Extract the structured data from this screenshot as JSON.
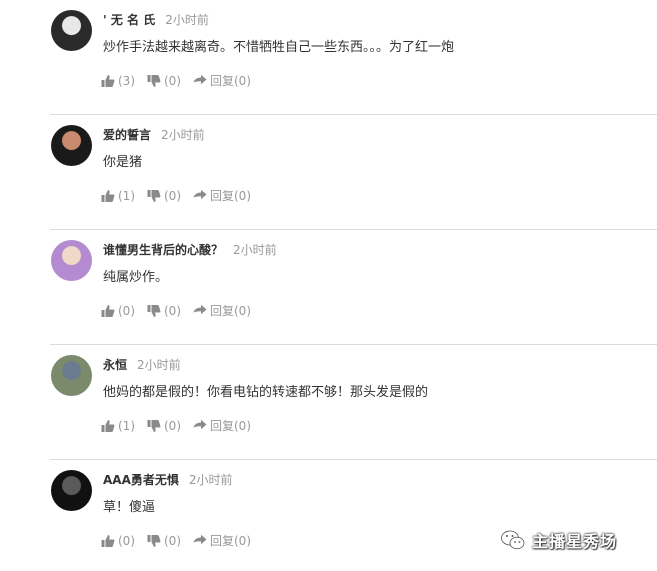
{
  "comments": [
    {
      "username": "' 无 名 氏",
      "time": "2小时前",
      "text": "炒作手法越来越离奇。不惜牺牲自己一些东西。。。为了红一炮",
      "likes": "(3)",
      "dislikes": "(0)",
      "reply": "回复(0)",
      "avatar_colors": [
        "#2a2a2a",
        "#e8e8e8"
      ]
    },
    {
      "username": "爱的誓言",
      "time": "2小时前",
      "text": "你是猪",
      "likes": "(1)",
      "dislikes": "(0)",
      "reply": "回复(0)",
      "avatar_colors": [
        "#1a1a1a",
        "#c98a70"
      ]
    },
    {
      "username": "谁懂男生背后的心酸？",
      "time": "2小时前",
      "text": "纯属炒作。",
      "likes": "(0)",
      "dislikes": "(0)",
      "reply": "回复(0)",
      "avatar_colors": [
        "#b48bd0",
        "#f0d9c8"
      ]
    },
    {
      "username": "永恒",
      "time": "2小时前",
      "text": "他妈的都是假的！你看电钻的转速都不够！那头发是假的",
      "likes": "(1)",
      "dislikes": "(0)",
      "reply": "回复(0)",
      "avatar_colors": [
        "#7a8a6a",
        "#6b7c90"
      ]
    },
    {
      "username": "AAA勇者无惧",
      "time": "2小时前",
      "text": "草！傻逼",
      "likes": "(0)",
      "dislikes": "(0)",
      "reply": "回复(0)",
      "avatar_colors": [
        "#111111",
        "#5a5a5a"
      ]
    }
  ],
  "watermark": {
    "text": "主播星秀场",
    "icon": "wechat-icon"
  },
  "colors": {
    "icon": "#8a8a8a",
    "meta": "#999999",
    "separator": "#dcdcdc"
  }
}
